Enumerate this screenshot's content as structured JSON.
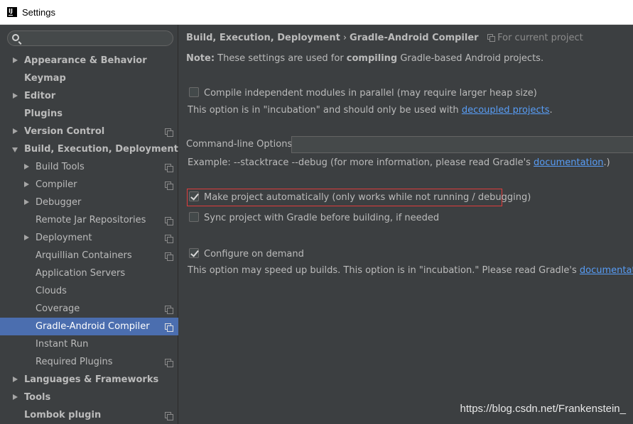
{
  "window": {
    "title": "Settings",
    "app_icon_text": "IJ"
  },
  "search": {
    "placeholder": ""
  },
  "sidebar": {
    "items": [
      {
        "label": "Appearance & Behavior",
        "level": 0,
        "arrow": "right",
        "project_icon": false,
        "selected": false
      },
      {
        "label": "Keymap",
        "level": 0,
        "arrow": "none",
        "project_icon": false,
        "selected": false
      },
      {
        "label": "Editor",
        "level": 0,
        "arrow": "right",
        "project_icon": false,
        "selected": false
      },
      {
        "label": "Plugins",
        "level": 0,
        "arrow": "none",
        "project_icon": false,
        "selected": false
      },
      {
        "label": "Version Control",
        "level": 0,
        "arrow": "right",
        "project_icon": true,
        "selected": false
      },
      {
        "label": "Build, Execution, Deployment",
        "level": 0,
        "arrow": "down",
        "project_icon": false,
        "selected": false
      },
      {
        "label": "Build Tools",
        "level": 1,
        "arrow": "right",
        "project_icon": true,
        "selected": false
      },
      {
        "label": "Compiler",
        "level": 1,
        "arrow": "right",
        "project_icon": true,
        "selected": false
      },
      {
        "label": "Debugger",
        "level": 1,
        "arrow": "right",
        "project_icon": false,
        "selected": false
      },
      {
        "label": "Remote Jar Repositories",
        "level": 1,
        "arrow": "none",
        "project_icon": true,
        "selected": false
      },
      {
        "label": "Deployment",
        "level": 1,
        "arrow": "right",
        "project_icon": true,
        "selected": false
      },
      {
        "label": "Arquillian Containers",
        "level": 1,
        "arrow": "none",
        "project_icon": true,
        "selected": false
      },
      {
        "label": "Application Servers",
        "level": 1,
        "arrow": "none",
        "project_icon": false,
        "selected": false
      },
      {
        "label": "Clouds",
        "level": 1,
        "arrow": "none",
        "project_icon": false,
        "selected": false
      },
      {
        "label": "Coverage",
        "level": 1,
        "arrow": "none",
        "project_icon": true,
        "selected": false
      },
      {
        "label": "Gradle-Android Compiler",
        "level": 1,
        "arrow": "none",
        "project_icon": true,
        "selected": true
      },
      {
        "label": "Instant Run",
        "level": 1,
        "arrow": "none",
        "project_icon": false,
        "selected": false
      },
      {
        "label": "Required Plugins",
        "level": 1,
        "arrow": "none",
        "project_icon": true,
        "selected": false
      },
      {
        "label": "Languages & Frameworks",
        "level": 0,
        "arrow": "right",
        "project_icon": false,
        "selected": false
      },
      {
        "label": "Tools",
        "level": 0,
        "arrow": "right",
        "project_icon": false,
        "selected": false
      },
      {
        "label": "Lombok plugin",
        "level": 0,
        "arrow": "none",
        "project_icon": true,
        "selected": false
      }
    ]
  },
  "main": {
    "breadcrumb": {
      "parent": "Build, Execution, Deployment",
      "separator": "›",
      "current": "Gradle-Android Compiler",
      "scope": "For current project"
    },
    "note": {
      "prefix": "Note:",
      "text1": " These settings are used for ",
      "bold": "compiling",
      "text2": " Gradle-based Android projects."
    },
    "parallel": {
      "label": "Compile independent modules in parallel (may require larger heap size)",
      "checked": false,
      "help_text": "This option is in \"incubation\" and should only be used with ",
      "link": "decoupled projects",
      "help_end": "."
    },
    "command_line": {
      "label": "Command-line Options:",
      "value": "",
      "example_text": "Example: --stacktrace --debug (for more information, please read Gradle's ",
      "example_link": "documentation",
      "example_end": ".)"
    },
    "make_auto": {
      "label": "Make project automatically (only works while not running / debugging)",
      "checked": true
    },
    "sync": {
      "label": "Sync project with Gradle before building, if needed",
      "checked": false
    },
    "configure": {
      "label": "Configure on demand",
      "checked": true,
      "help_text": "This option may speed up builds. This option is in \"incubation.\" Please read Gradle's ",
      "link": "documentation",
      "help_end": "."
    }
  },
  "watermark": "https://blog.csdn.net/Frankenstein_",
  "colors": {
    "background": "#3c3f41",
    "selection": "#4b6eaf",
    "link": "#589df6",
    "highlight_border": "#e03c3c"
  }
}
